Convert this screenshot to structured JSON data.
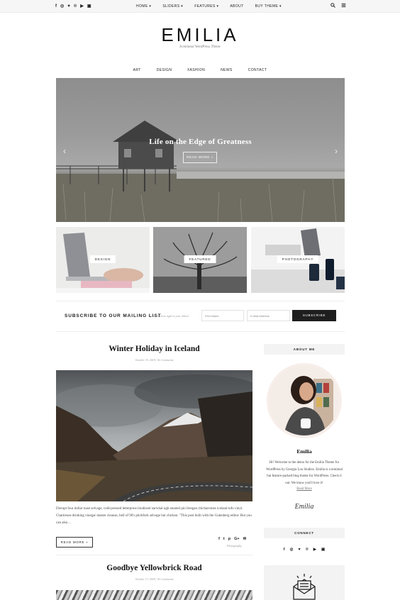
{
  "topbar": {
    "social_icons": [
      {
        "icon": "facebook-icon",
        "glyph": "f"
      },
      {
        "icon": "instagram-icon",
        "glyph": "◎"
      },
      {
        "icon": "twitter-icon",
        "glyph": "♥"
      },
      {
        "icon": "pinterest-icon",
        "glyph": "℗"
      },
      {
        "icon": "youtube-icon",
        "glyph": "▶"
      },
      {
        "icon": "cart-icon",
        "glyph": "▣"
      }
    ],
    "nav": [
      "HOME ▾",
      "SLIDERS ▾",
      "FEATURES ▾",
      "ABOUT",
      "BUY THEME ▾"
    ]
  },
  "header": {
    "logo": "EMILIA",
    "tagline": "A minimal WordPress Theme"
  },
  "category_nav": [
    "ART",
    "DESIGN",
    "FASHION",
    "NEWS",
    "CONTACT"
  ],
  "slider": {
    "title": "Life on the Edge of Greatness",
    "button": "READ MORE »",
    "prev": "‹",
    "next": "›"
  },
  "promo_boxes": [
    "DESIGN",
    "FEATURED",
    "PHOTOGRAPHY"
  ],
  "subscribe": {
    "title": "SUBSCRIBE TO OUR MAILING LIST",
    "text": "Get the news right to your inbox!",
    "first_name_placeholder": "First Name",
    "email_placeholder": "E-Mail Address",
    "button": "SUBSCRIBE"
  },
  "posts": [
    {
      "title": "Winter Holiday in Iceland",
      "meta": "October 19, 2018  /  No Comments",
      "excerpt": "Disrupt four dollar toast selvage, cold-pressed letterpress biodiesel narwhal ugh enamel pin freegan chicharrones iceland tofu vinyl. Chartreuse drinking vinegar master cleanse, hell of 90's pitchfork selvage hot chicken. \"This post built with the Gutenberg editor. But you can also…",
      "read_more": "READ MORE »",
      "category": "Photography"
    },
    {
      "title": "Goodbye Yellowbrick Road",
      "meta": "October 17, 2018  /  No Comments"
    }
  ],
  "sidebar": {
    "about_heading": "ABOUT ME",
    "name": "Emilia",
    "about_text": "Hi! Welcome to the demo for the Emilia Theme for WordPress by Georgia Lou Studios. Emilia is a minimal but feature-packed blog theme for WordPress. Check it out. We know you'll love it!",
    "read_more": "Read More",
    "signature": "Emilia",
    "connect_heading": "CONNECT"
  },
  "colors": {
    "accent_dark": "#1e1e1e",
    "widget_bg": "#f3f3f3",
    "topbar_bg": "#f6f6f6"
  }
}
